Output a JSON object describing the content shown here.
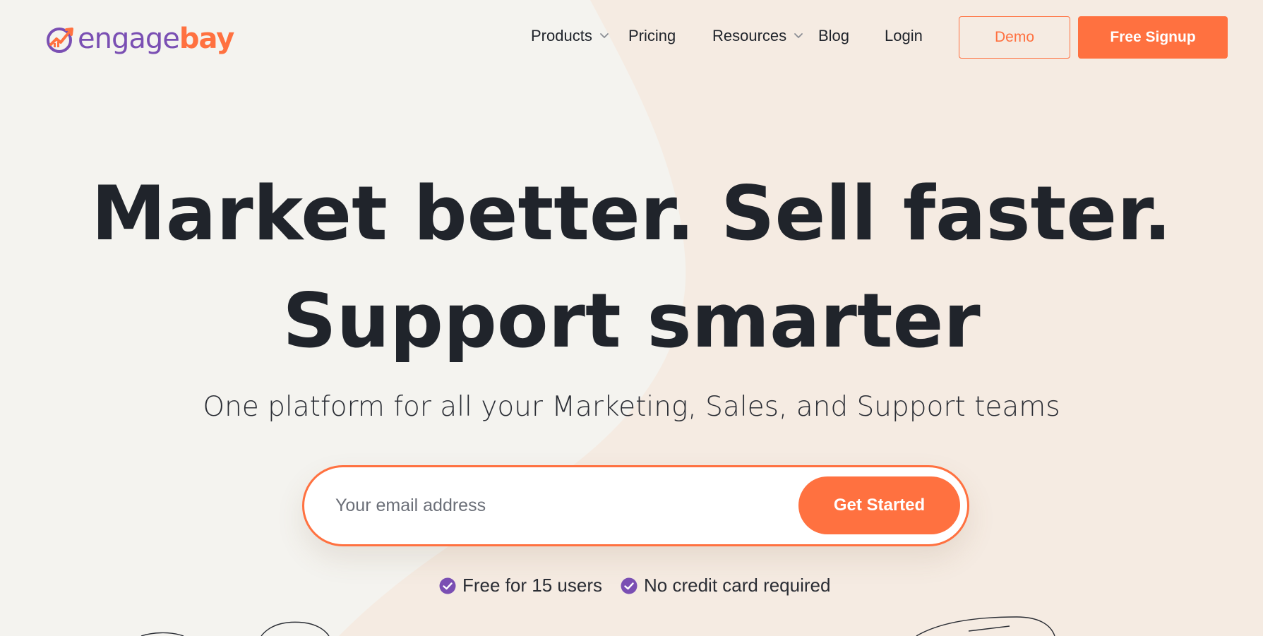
{
  "brand": {
    "name_part1": "engage",
    "name_part2": "bay",
    "color_primary": "#7a4fb3",
    "color_accent": "#ff7140"
  },
  "nav": {
    "items": [
      {
        "label": "Products",
        "has_dropdown": true
      },
      {
        "label": "Pricing",
        "has_dropdown": false
      },
      {
        "label": "Resources",
        "has_dropdown": true
      },
      {
        "label": "Blog",
        "has_dropdown": false
      },
      {
        "label": "Login",
        "has_dropdown": false
      }
    ],
    "demo_label": "Demo",
    "signup_label": "Free Signup"
  },
  "hero": {
    "headline_line1": "Market better. Sell faster.",
    "headline_line2": "Support smarter",
    "subheadline": "One platform for all your Marketing, Sales, and Support teams",
    "email_placeholder": "Your email address",
    "cta_label": "Get Started",
    "perks": [
      {
        "icon": "check-circle-icon",
        "label": "Free for 15 users"
      },
      {
        "icon": "check-circle-icon",
        "label": "No credit card required"
      }
    ]
  },
  "colors": {
    "background": "#f4f3ef",
    "background_warm": "#f5ebe2",
    "text": "#20242b",
    "check": "#7a4fb3"
  }
}
